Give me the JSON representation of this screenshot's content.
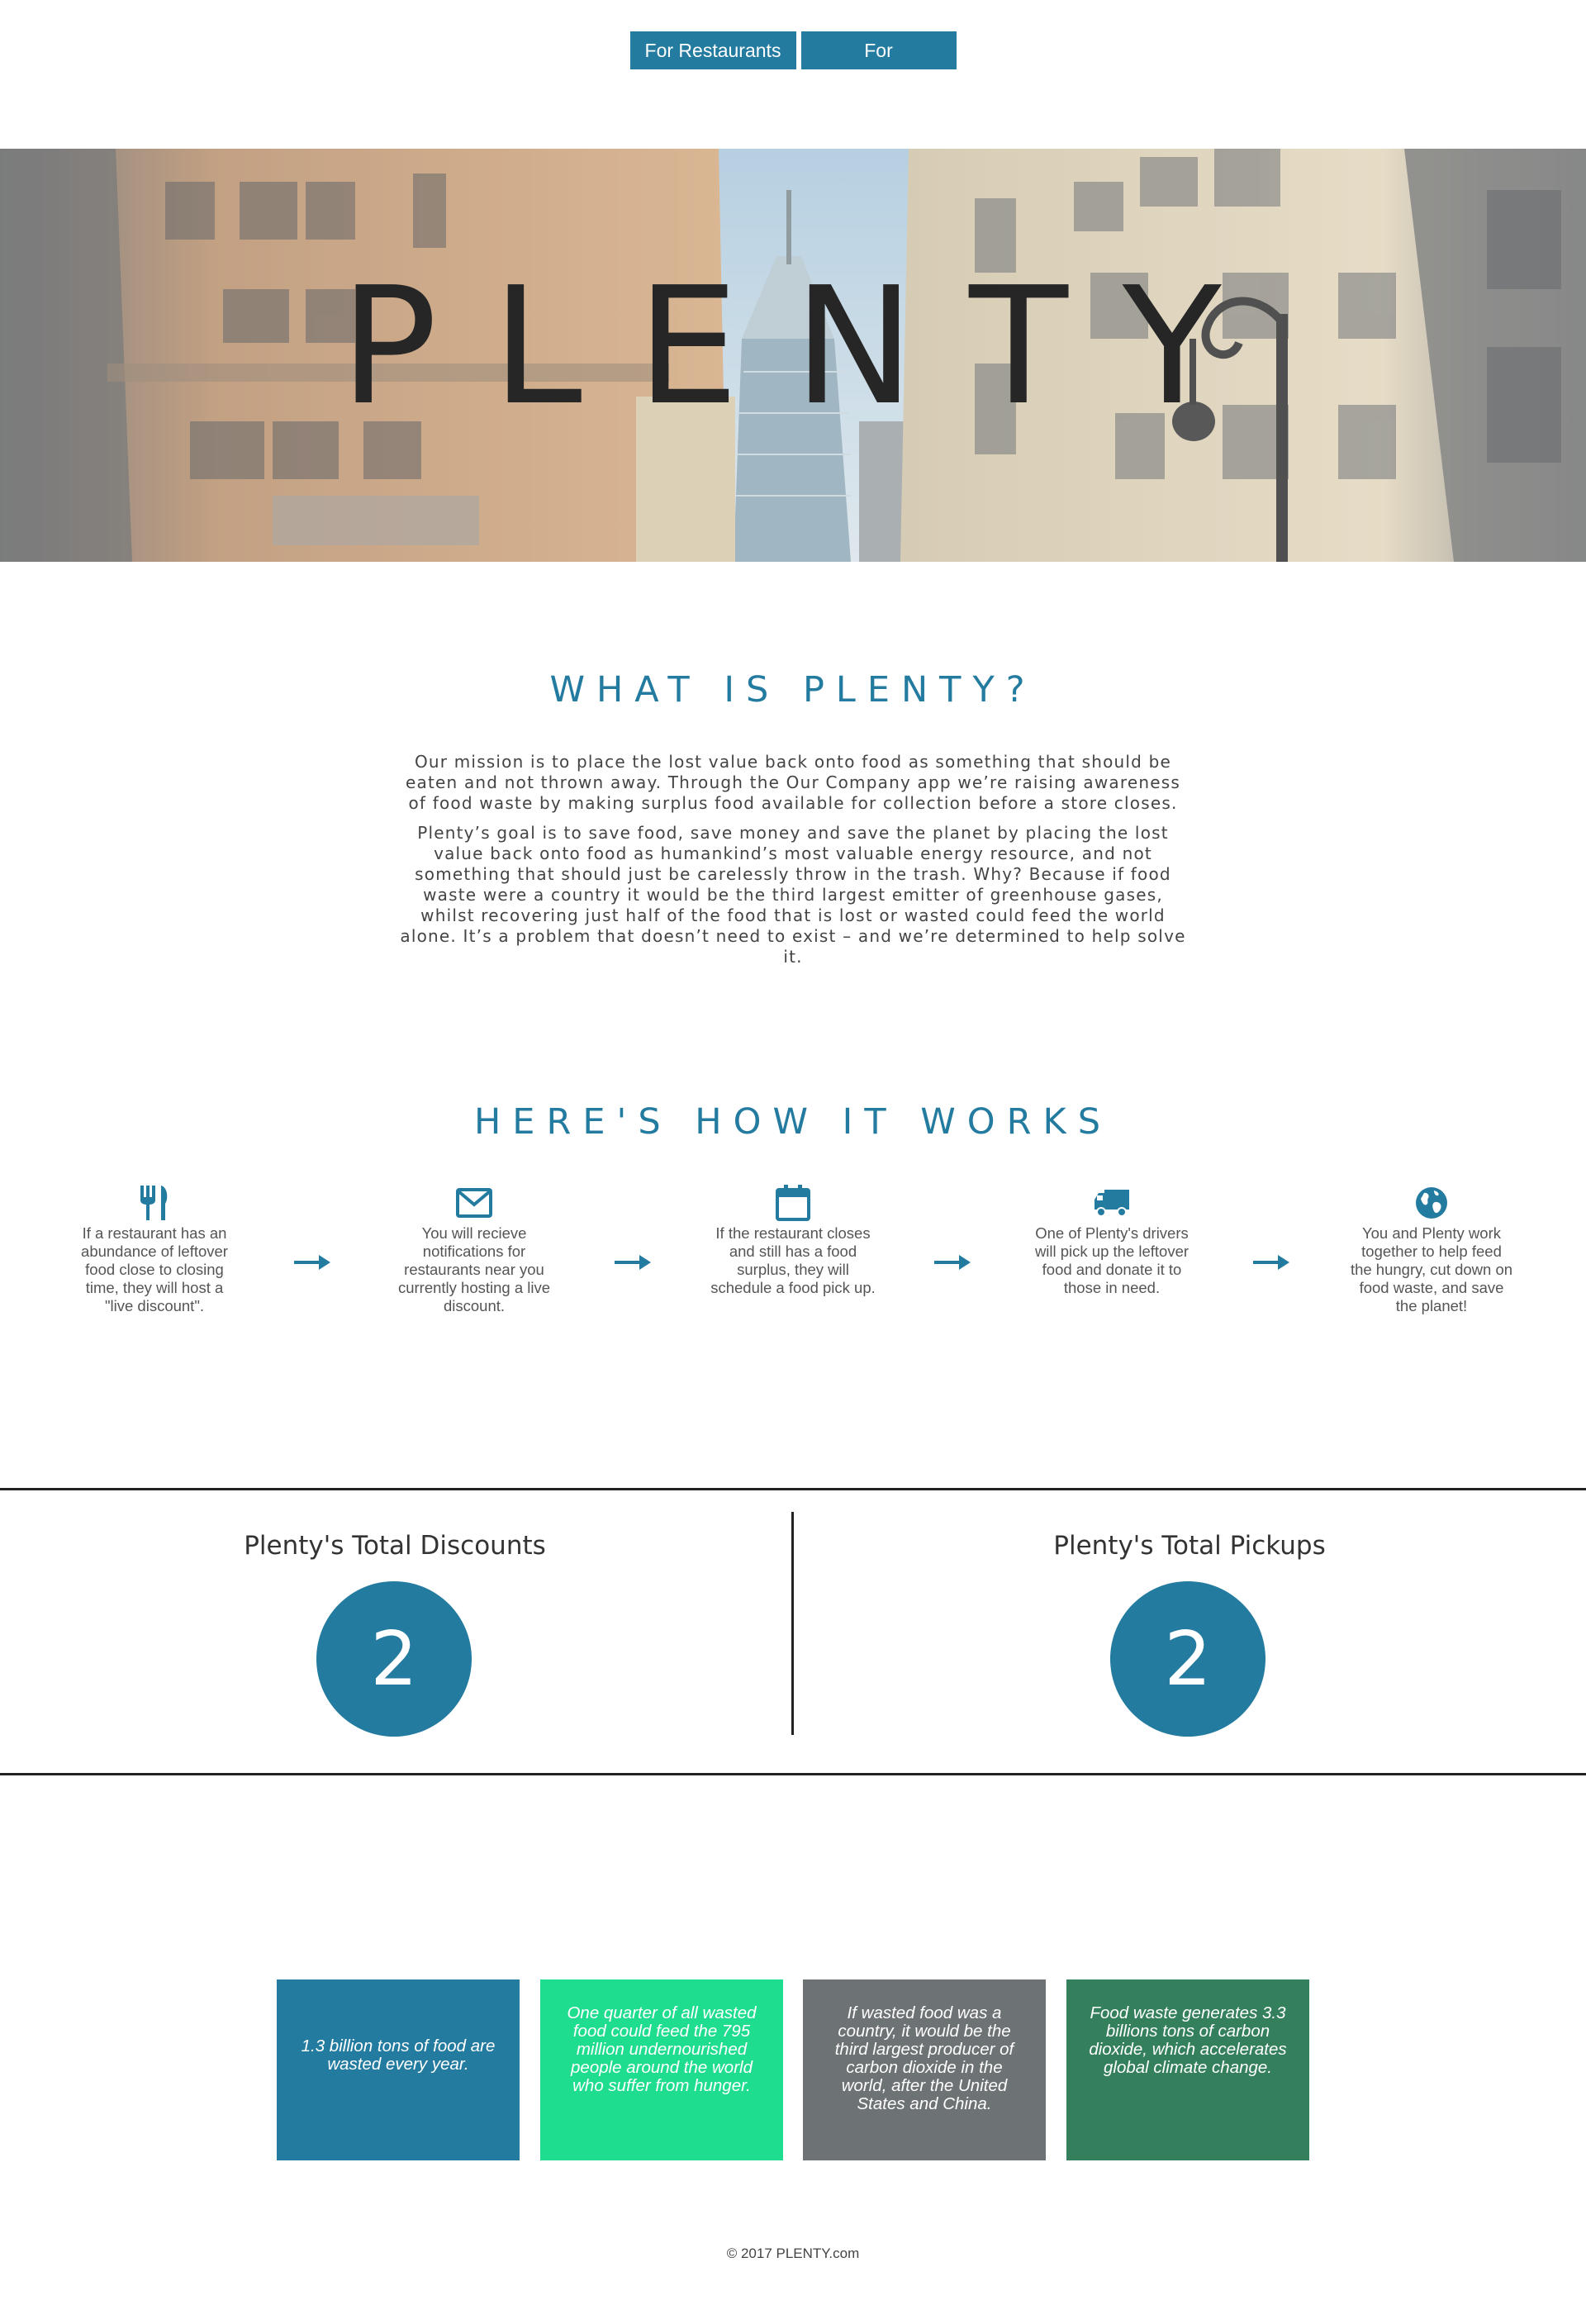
{
  "nav": {
    "restaurants_label": "For Restaurants",
    "customers_label": "For Customers"
  },
  "hero": {
    "title": "PLENTY"
  },
  "about": {
    "title": "WHAT IS PLENTY?",
    "paragraphs": [
      "Our mission is to place the lost value back onto food as something that should be eaten and not thrown away. Through the Our Company app we’re raising awareness of food waste by making surplus food available for collection before a store closes.",
      "Plenty’s goal is to save food, save money and save the planet by placing the lost value back onto food as humankind’s most valuable energy resource, and not something that should just be carelessly throw in the trash. Why? Because if food waste were a country it would be the third largest emitter of greenhouse gases, whilst recovering just half of the food that is lost or wasted could feed the world alone. It’s a problem that doesn’t need to exist – and we’re determined to help solve it."
    ]
  },
  "how": {
    "title": "HERE'S HOW IT WORKS",
    "steps": [
      {
        "icon": "utensils-icon",
        "text": "If a restaurant has an abundance of leftover food close to closing time, they will host a \"live discount\"."
      },
      {
        "icon": "envelope-icon",
        "text": "You will recieve notifications for restaurants near you currently hosting a live discount."
      },
      {
        "icon": "calendar-icon",
        "text": "If the restaurant closes and still has a food surplus, they will schedule a food pick up."
      },
      {
        "icon": "truck-icon",
        "text": "One of Plenty's drivers will pick up the leftover food and donate it to those in need."
      },
      {
        "icon": "globe-icon",
        "text": "You and Plenty work together to help feed the hungry, cut down on food waste, and save the planet!"
      }
    ]
  },
  "stats": {
    "discounts_label": "Plenty's Total Discounts",
    "discounts_value": "2",
    "pickups_label": "Plenty's Total Pickups",
    "pickups_value": "2"
  },
  "facts": [
    {
      "text": "1.3 billion tons of food are wasted every year.",
      "color": "#247ba0"
    },
    {
      "text": "One quarter of all wasted food could feed the 795 million undernourished people around the world who suffer from hunger.",
      "color": "#1fdd8f"
    },
    {
      "text": "If wasted food was a country, it would be the third largest producer of carbon dioxide in the world, after the United States and China.",
      "color": "#6d7275"
    },
    {
      "text": "Food waste generates 3.3 billions tons of carbon dioxide, which accelerates global climate change.",
      "color": "#34805c"
    }
  ],
  "footer": {
    "copyright": "© 2017 PLENTY.com"
  },
  "colors": {
    "accent": "#247ba0",
    "text": "#333333"
  }
}
